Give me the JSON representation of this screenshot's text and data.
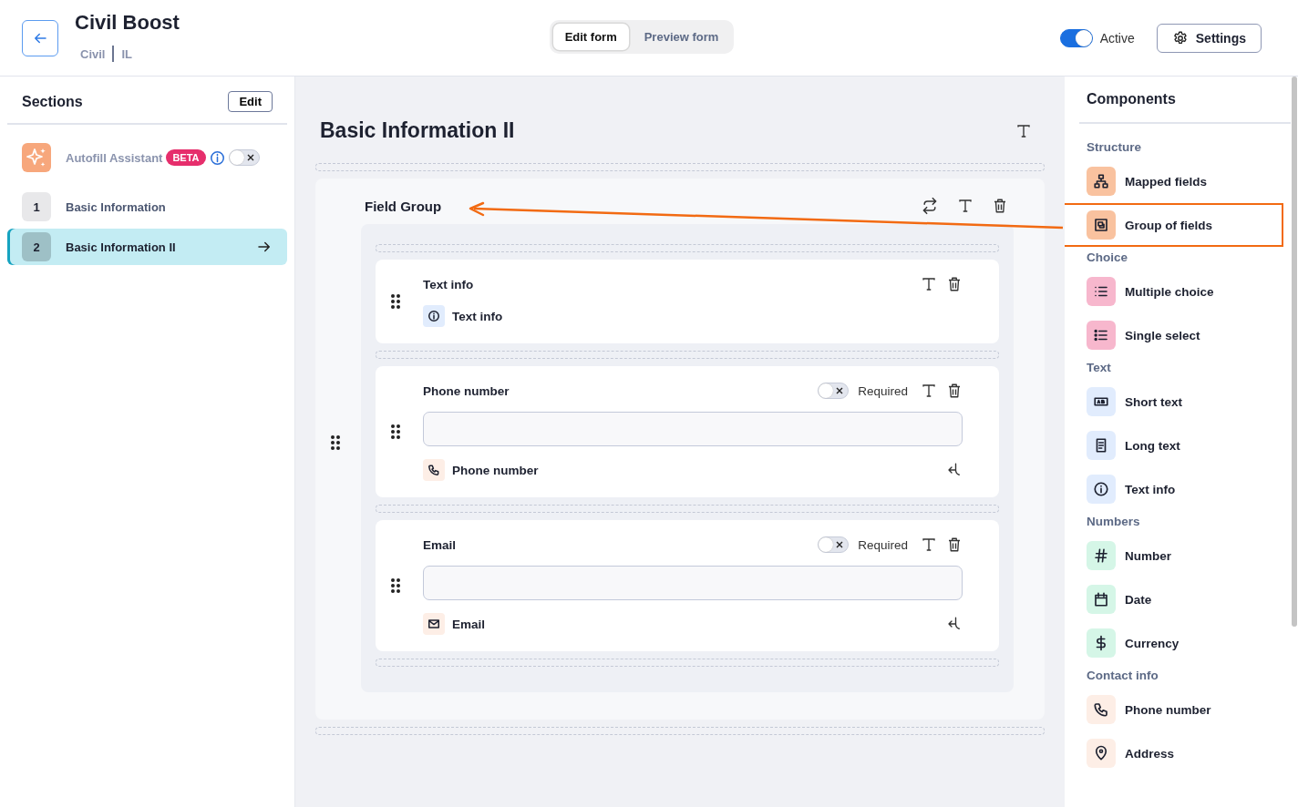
{
  "header": {
    "title": "Civil Boost",
    "breadcrumb": [
      "Civil",
      "IL"
    ],
    "modes": [
      {
        "label": "Edit form",
        "selected": true
      },
      {
        "label": "Preview form",
        "selected": false
      }
    ],
    "active": {
      "label": "Active",
      "on": true
    },
    "settings_button": "Settings"
  },
  "sections_panel": {
    "title": "Sections",
    "edit_button": "Edit",
    "autofill": {
      "label": "Autofill Assistant",
      "badge": "BETA",
      "on": false
    },
    "items": [
      {
        "number": "1",
        "label": "Basic Information",
        "selected": false
      },
      {
        "number": "2",
        "label": "Basic Information II",
        "selected": true
      }
    ]
  },
  "canvas": {
    "title": "Basic Information II",
    "group": {
      "title": "Field Group",
      "fields": [
        {
          "kind": "info",
          "label": "Text info",
          "type_label": "Text info"
        },
        {
          "kind": "input",
          "label": "Phone number",
          "required_label": "Required",
          "required": false,
          "type_label": "Phone number"
        },
        {
          "kind": "input",
          "label": "Email",
          "required_label": "Required",
          "required": false,
          "type_label": "Email"
        }
      ]
    }
  },
  "components_panel": {
    "title": "Components",
    "groups": [
      {
        "title": "Structure",
        "items": [
          {
            "label": "Mapped fields",
            "color": "#f9c29f",
            "highlighted": false
          },
          {
            "label": "Group of fields",
            "color": "#f9c29f",
            "highlighted": true
          }
        ]
      },
      {
        "title": "Choice",
        "items": [
          {
            "label": "Multiple choice",
            "color": "#f7b7cd",
            "highlighted": false
          },
          {
            "label": "Single select",
            "color": "#f7b7cd",
            "highlighted": false
          }
        ]
      },
      {
        "title": "Text",
        "items": [
          {
            "label": "Short text",
            "color": "#e1ecfd",
            "highlighted": false
          },
          {
            "label": "Long text",
            "color": "#e1ecfd",
            "highlighted": false
          },
          {
            "label": "Text info",
            "color": "#e1ecfd",
            "highlighted": false
          }
        ]
      },
      {
        "title": "Numbers",
        "items": [
          {
            "label": "Number",
            "color": "#d5f6e7",
            "highlighted": false
          },
          {
            "label": "Date",
            "color": "#d5f6e7",
            "highlighted": false
          },
          {
            "label": "Currency",
            "color": "#d5f6e7",
            "highlighted": false
          }
        ]
      },
      {
        "title": "Contact info",
        "items": [
          {
            "label": "Phone number",
            "color": "#fdeee6",
            "highlighted": false
          },
          {
            "label": "Address",
            "color": "#fdeee6",
            "highlighted": false
          }
        ]
      }
    ]
  }
}
